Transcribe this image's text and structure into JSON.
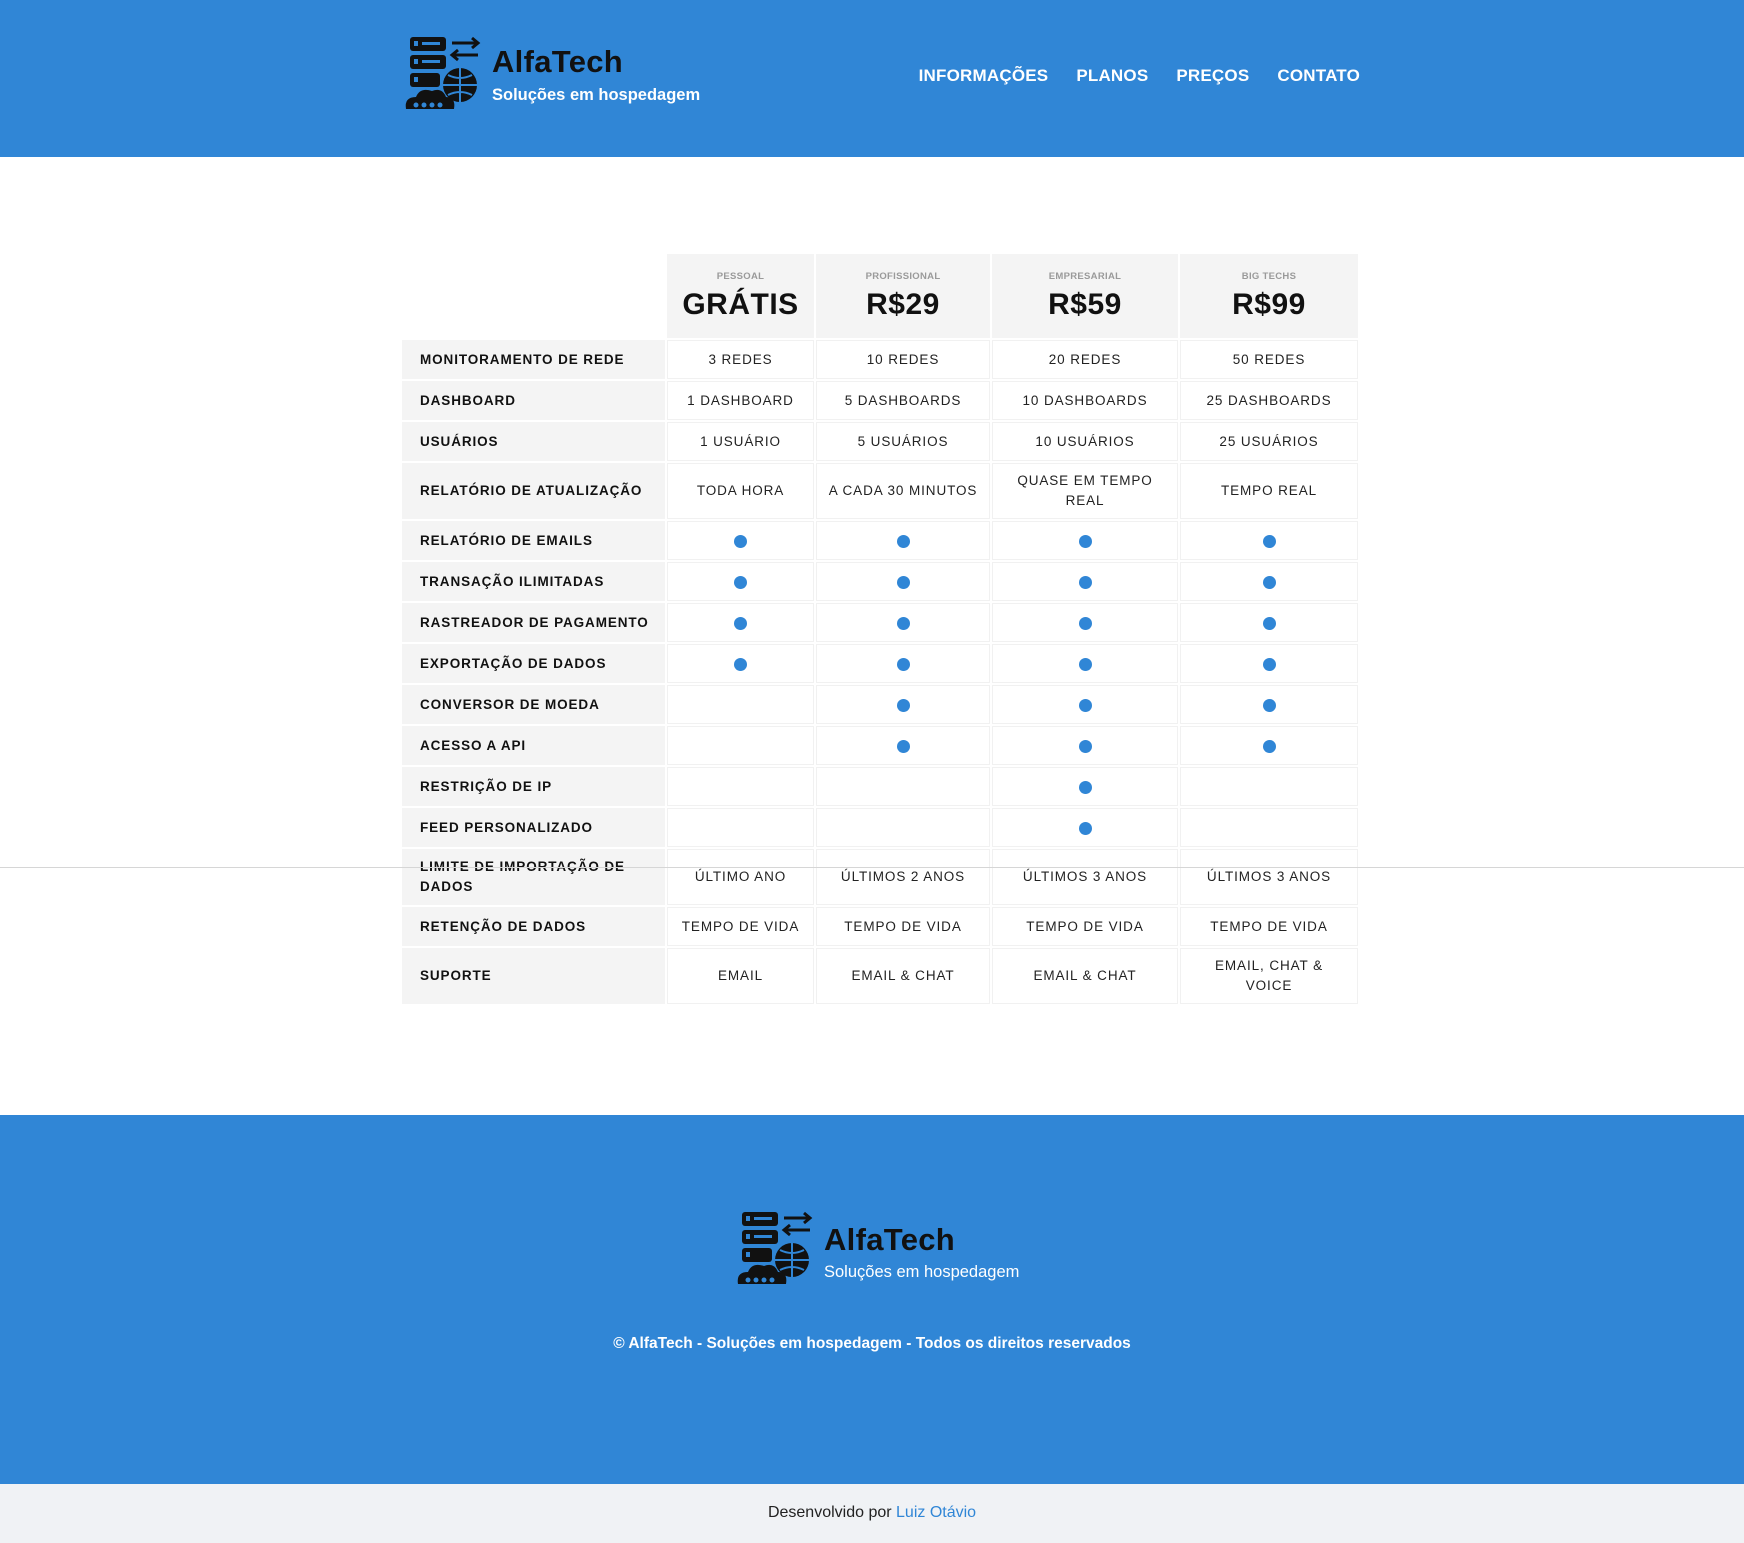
{
  "brand": {
    "name": "AlfaTech",
    "tagline": "Soluções em hospedagem",
    "logo_icon": "server-cloud-icon"
  },
  "nav": [
    {
      "label": "INFORMAÇÕES"
    },
    {
      "label": "PLANOS"
    },
    {
      "label": "PREÇOS"
    },
    {
      "label": "CONTATO"
    }
  ],
  "plans": [
    {
      "tier": "PESSOAL",
      "price": "GRÁTIS"
    },
    {
      "tier": "PROFISSIONAL",
      "price": "R$29"
    },
    {
      "tier": "EMPRESARIAL",
      "price": "R$59"
    },
    {
      "tier": "BIG TECHS",
      "price": "R$99"
    }
  ],
  "features": [
    {
      "label": "MONITORAMENTO DE REDE",
      "values": [
        "3 REDES",
        "10 REDES",
        "20 REDES",
        "50 REDES"
      ]
    },
    {
      "label": "DASHBOARD",
      "values": [
        "1 DASHBOARD",
        "5 DASHBOARDS",
        "10 DASHBOARDS",
        "25 DASHBOARDS"
      ]
    },
    {
      "label": "USUÁRIOS",
      "values": [
        "1 USUÁRIO",
        "5 USUÁRIOS",
        "10 USUÁRIOS",
        "25 USUÁRIOS"
      ]
    },
    {
      "label": "RELATÓRIO DE ATUALIZAÇÃO",
      "values": [
        "TODA HORA",
        "A CADA 30 MINUTOS",
        "QUASE EM TEMPO REAL",
        "TEMPO REAL"
      ]
    },
    {
      "label": "RELATÓRIO DE EMAILS",
      "included": [
        true,
        true,
        true,
        true
      ]
    },
    {
      "label": "TRANSAÇÃO ILIMITADAS",
      "included": [
        true,
        true,
        true,
        true
      ]
    },
    {
      "label": "RASTREADOR DE PAGAMENTO",
      "included": [
        true,
        true,
        true,
        true
      ]
    },
    {
      "label": "EXPORTAÇÃO DE DADOS",
      "included": [
        true,
        true,
        true,
        true
      ]
    },
    {
      "label": "CONVERSOR DE MOEDA",
      "included": [
        false,
        true,
        true,
        true
      ]
    },
    {
      "label": "ACESSO A API",
      "included": [
        false,
        true,
        true,
        true
      ]
    },
    {
      "label": "RESTRIÇÃO DE IP",
      "included": [
        false,
        false,
        true,
        false
      ]
    },
    {
      "label": "FEED PERSONALIZADO",
      "included": [
        false,
        false,
        true,
        false
      ]
    },
    {
      "label": "LIMITE DE IMPORTAÇÃO DE DADOS",
      "values": [
        "ÚLTIMO ANO",
        "ÚLTIMOS 2 ANOS",
        "ÚLTIMOS 3 ANOS",
        "ÚLTIMOS 3 ANOS"
      ]
    },
    {
      "label": "RETENÇÃO DE DADOS",
      "values": [
        "TEMPO DE VIDA",
        "TEMPO DE VIDA",
        "TEMPO DE VIDA",
        "TEMPO DE VIDA"
      ]
    },
    {
      "label": "SUPORTE",
      "values": [
        "EMAIL",
        "EMAIL & CHAT",
        "EMAIL & CHAT",
        "EMAIL, CHAT & VOICE"
      ]
    }
  ],
  "footer": {
    "copyright": "© AlfaTech - Soluções em hospedagem - Todos os direitos reservados",
    "credit_prefix": "Desenvolvido por",
    "credit_name": "Luiz Otávio"
  },
  "colors": {
    "accent": "#3086d6",
    "footer_bottom": "#f0f2f5"
  }
}
